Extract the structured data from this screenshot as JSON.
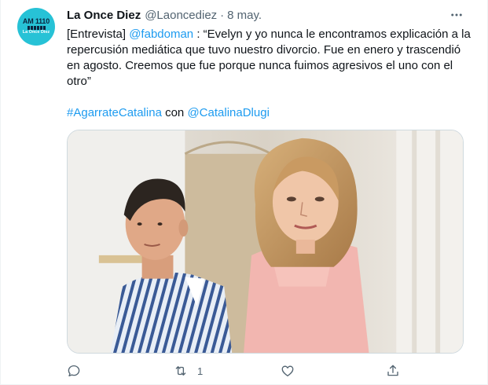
{
  "tweet": {
    "avatar": {
      "logo_top": "AM 1110",
      "logo_bottom": "La Once Diez"
    },
    "display_name": "La Once Diez",
    "handle": "@Laoncediez",
    "separator": "·",
    "date": "8 may.",
    "text_prefix": "[Entrevista] ",
    "mention": "@fabdoman",
    "text_body": " : “Evelyn y yo nunca le encontramos explicación a la repercusión mediática que tuvo nuestro divorcio. Fue en enero y trascendió en agosto. Creemos que fue porque nunca fuimos agresivos el uno con el otro”",
    "hashtag": "#AgarrateCatalina",
    "con_word": " con ",
    "mention_2": "@CatalinaDlugi",
    "actions": {
      "reply_count": "",
      "retweet_count": "1",
      "like_count": ""
    },
    "icons": {
      "more": "more-horizontal-icon",
      "reply": "reply-icon",
      "retweet": "retweet-icon",
      "like": "heart-icon",
      "share": "share-icon"
    },
    "colors": {
      "link": "#1d9bf0",
      "secondary_text": "#536471",
      "avatar_bg": "#27c2d6"
    }
  }
}
